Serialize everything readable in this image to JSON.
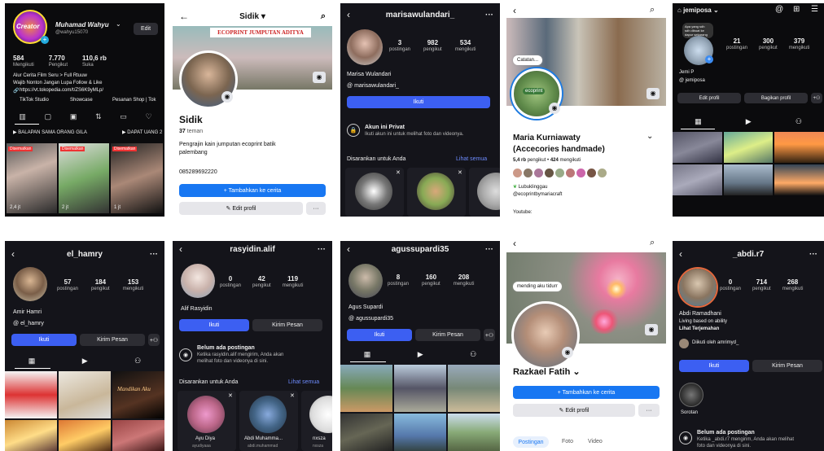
{
  "p1": {
    "name": "Muhamad Wahyu",
    "handle": "@wahyu15070",
    "edit": "Edit",
    "stats": [
      {
        "v": "584",
        "l": "Mengikuti"
      },
      {
        "v": "7.770",
        "l": "Pengikut"
      },
      {
        "v": "110,6 rb",
        "l": "Suka"
      }
    ],
    "bio1": "Alur Cerita Film Seru > Full Rtuuw",
    "bio2": "Wajib Nonton Jangan Lupa Follow & Like",
    "link": "https://vt.tokopedia.com/t/ZS6K9yMLp/",
    "studio": "TikTok Studio",
    "showcase": "Showcase",
    "shop": "Pesanan Shop | Tok",
    "playlist1": "BALAPAN SAMA ORANG GILA",
    "playlist2": "DAPAT UANG 2",
    "badge": "Disematkan",
    "views": [
      "2,4 jt",
      "2 jt",
      "1 jt"
    ],
    "logo_text": "Creator"
  },
  "p2": {
    "header": "Sidik",
    "banner": "ECOPRINT JUMPUTAN ADITYA",
    "name": "Sidik",
    "friends_count": "37",
    "friends_label": "teman",
    "bio1": "Pengrajin kain jumputan ecoprint batik",
    "bio2": "palembang",
    "phone": "085289692220",
    "story_btn": "+ Tambahkan ke cerita",
    "edit_btn": "Edit profil",
    "more": "···"
  },
  "p3": {
    "header": "marisawulandari_",
    "stats": [
      {
        "v": "3",
        "l": "postingan"
      },
      {
        "v": "982",
        "l": "pengikut"
      },
      {
        "v": "534",
        "l": "mengikuti"
      }
    ],
    "name": "Marisa Wulandari",
    "threads": "marisawulandari_",
    "follow": "Ikuti",
    "private_title": "Akun ini Privat",
    "private_sub": "Ikuti akun ini untuk melihat foto dan videonya.",
    "suggest": "Disarankan untuk Anda",
    "see_all": "Lihat semua"
  },
  "p4": {
    "note": "Catatan...",
    "name1": "Maria Kurniawaty",
    "name2": "(Accecories handmade)",
    "followers_count": "5,4 rb",
    "followers_label": "pengikut",
    "following_count": "424",
    "following_label": "mengikuti",
    "loc": "Lubuklinggau",
    "ig": "@ecoprintbymariacraft",
    "yt": "Youtube:",
    "logo": "ecoprint"
  },
  "p5": {
    "header": "jemiposa",
    "note": "Apa yang sdh sdh dibuat ke dapur sekarang",
    "stats": [
      {
        "v": "21",
        "l": "postingan"
      },
      {
        "v": "300",
        "l": "pengikut"
      },
      {
        "v": "379",
        "l": "mengikuti"
      }
    ],
    "name": "Jemi P",
    "threads": "jemiposa",
    "edit": "Edit profil",
    "share": "Bagikan profil"
  },
  "p6": {
    "header": "el_hamry",
    "stats": [
      {
        "v": "57",
        "l": "postingan"
      },
      {
        "v": "184",
        "l": "pengikut"
      },
      {
        "v": "153",
        "l": "mengikuti"
      }
    ],
    "name": "Amir Hamri",
    "threads": "el_hamry",
    "follow": "Ikuti",
    "message": "Kirim Pesan",
    "thumb_title": "Mandikan Aku"
  },
  "p7": {
    "header": "rasyidin.alif",
    "stats": [
      {
        "v": "0",
        "l": "postingan"
      },
      {
        "v": "42",
        "l": "pengikut"
      },
      {
        "v": "119",
        "l": "mengikuti"
      }
    ],
    "name": "Alif Rasyidin",
    "follow": "Ikuti",
    "message": "Kirim Pesan",
    "empty_title": "Belum ada postingan",
    "empty_sub1": "Ketika rasyidin.alif mengirim, Anda akan",
    "empty_sub2": "melihat foto dan videonya di sini.",
    "suggest": "Disarankan untuk Anda",
    "see_all": "Lihat semua",
    "cards": [
      {
        "n": "Ayu Diya",
        "u": "ayudiyaaa"
      },
      {
        "n": "Abdi Muhamma...",
        "u": "abdi.muhammad"
      },
      {
        "n": "nxsza",
        "u": "nxsza"
      }
    ]
  },
  "p8": {
    "header": "agussupardi35",
    "stats": [
      {
        "v": "8",
        "l": "postingan"
      },
      {
        "v": "160",
        "l": "pengikut"
      },
      {
        "v": "208",
        "l": "mengikuti"
      }
    ],
    "name": "Agus Supardi",
    "threads": "agussupardi35",
    "follow": "Ikuti",
    "message": "Kirim Pesan"
  },
  "p9": {
    "note": "mending aku tidurr",
    "name": "Razkael Fatih",
    "story_btn": "+ Tambahkan ke cerita",
    "edit_btn": "Edit profil",
    "more": "···",
    "tabs": [
      "Postingan",
      "Foto",
      "Video"
    ]
  },
  "p10": {
    "header": "_abdi.r7",
    "stats": [
      {
        "v": "0",
        "l": "postingan"
      },
      {
        "v": "714",
        "l": "pengikut"
      },
      {
        "v": "268",
        "l": "mengikuti"
      }
    ],
    "name": "Abdi Ramadhani",
    "bio": "Living based on ability",
    "translate": "Lihat Terjemahan",
    "followed_by": "Diikuti oleh amrimyd_",
    "follow": "Ikuti",
    "message": "Kirim Pesan",
    "highlight": "Sorotan",
    "empty_title": "Belum ada postingan",
    "empty_sub1": "Ketika _abdi.r7 mengirim, Anda akan melihat",
    "empty_sub2": "foto dan videonya di sini."
  }
}
